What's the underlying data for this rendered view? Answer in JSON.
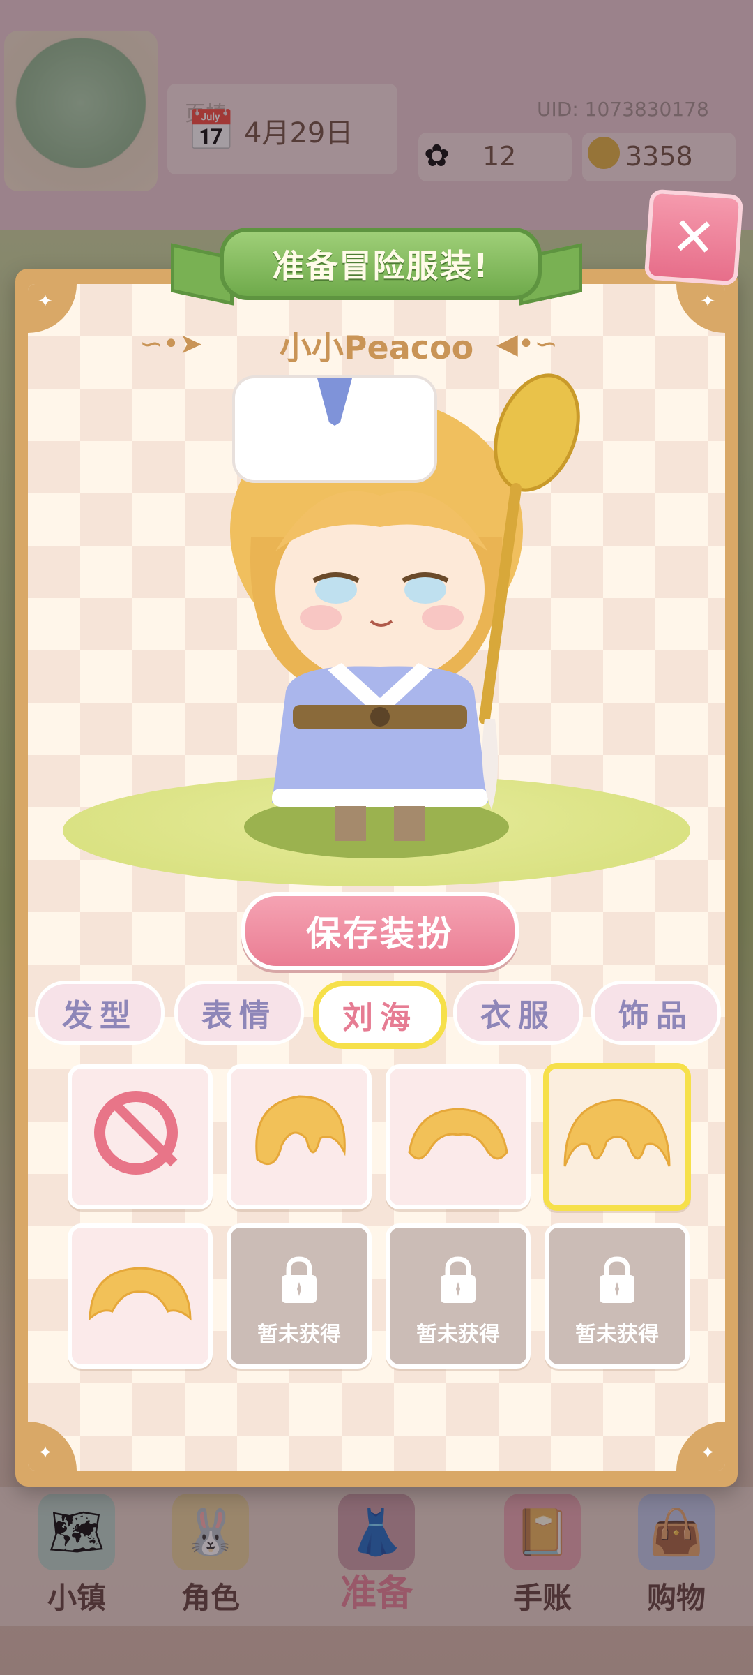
{
  "hud": {
    "player_name": "页椿",
    "uid": "UID: 1073830178",
    "date": "4月29日",
    "flowers": "12",
    "coins": "3358"
  },
  "modal": {
    "title": "准备冒险服装!",
    "character_name": "小小Peacoo",
    "save_label": "保存装扮",
    "close_icon": "close-icon"
  },
  "tabs": [
    {
      "label": "发型",
      "active": false
    },
    {
      "label": "表情",
      "active": false
    },
    {
      "label": "刘海",
      "active": true
    },
    {
      "label": "衣服",
      "active": false
    },
    {
      "label": "饰品",
      "active": false
    }
  ],
  "items": [
    {
      "type": "none",
      "icon": "none-icon"
    },
    {
      "type": "hair",
      "icon": "bangs-style-1-icon"
    },
    {
      "type": "hair",
      "icon": "bangs-style-2-icon"
    },
    {
      "type": "hair",
      "icon": "bangs-style-3-icon",
      "selected": true
    },
    {
      "type": "hair",
      "icon": "bangs-style-4-icon"
    },
    {
      "type": "locked",
      "label": "暂未获得"
    },
    {
      "type": "locked",
      "label": "暂未获得"
    },
    {
      "type": "locked",
      "label": "暂未获得"
    }
  ],
  "nav": [
    {
      "label": "小镇",
      "icon": "map-icon"
    },
    {
      "label": "角色",
      "icon": "character-icon"
    },
    {
      "label": "准备",
      "icon": "wardrobe-icon",
      "active": true
    },
    {
      "label": "手账",
      "icon": "notebook-icon"
    },
    {
      "label": "购物",
      "icon": "shopping-bag-icon"
    }
  ],
  "colors": {
    "accent_yellow": "#f6e04a",
    "pink": "#ea7d93",
    "banner_green": "#6faa4b",
    "frame": "#d9a867"
  }
}
